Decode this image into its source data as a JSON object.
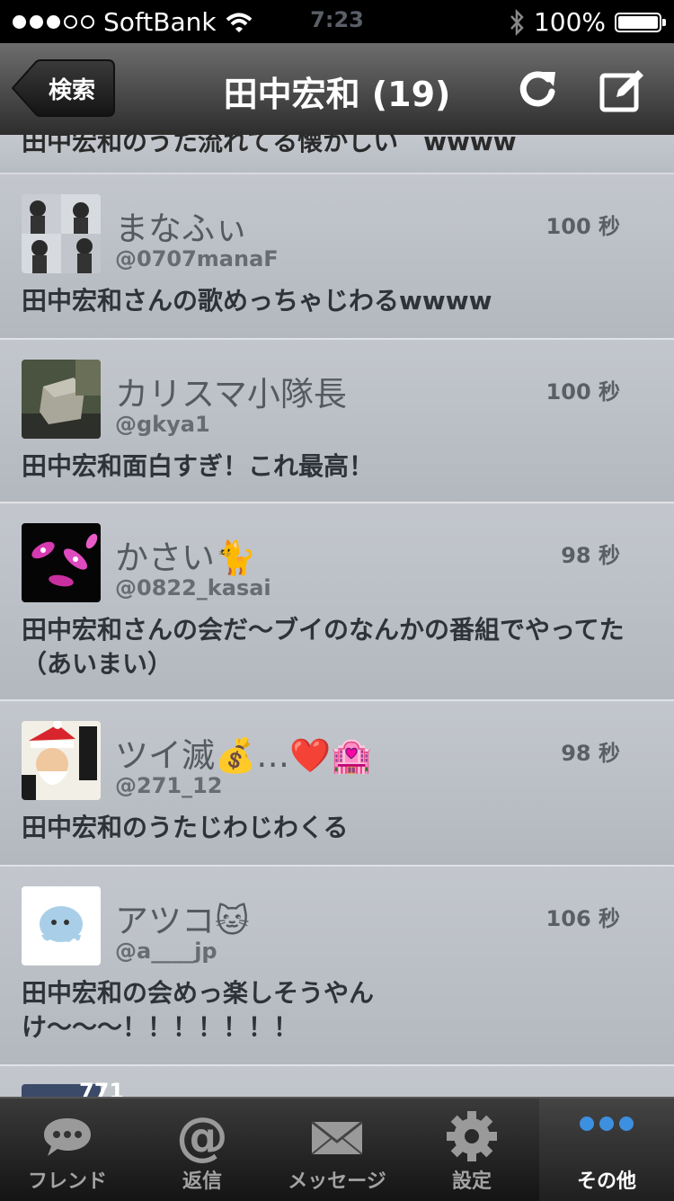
{
  "status_bar": {
    "carrier": "SoftBank",
    "time": "7:23",
    "battery": "100%"
  },
  "nav": {
    "back_label": "検索",
    "title": "田中宏和 (19)",
    "refresh_icon": "refresh-icon",
    "compose_icon": "compose-icon"
  },
  "partial_top_text": "田中宏和のうた流れてる懐かしい　wwww",
  "tweets": [
    {
      "name": "まなふぃ",
      "handle": "@0707manaF",
      "time": "100 秒",
      "text": "田中宏和さんの歌めっちゃじわるwwww"
    },
    {
      "name": "カリスマ小隊長",
      "handle": "@gkya1",
      "time": "100 秒",
      "text": "田中宏和面白すぎ！これ最高！"
    },
    {
      "name": "かさい🐈",
      "handle": "@0822_kasai",
      "time": "98 秒",
      "text": "田中宏和さんの会だ〜ブイのなんかの番組でやってた（あいまい）"
    },
    {
      "name": "ツイ滅💰…❤️🏩",
      "handle": "@271_12",
      "time": "98 秒",
      "text": "田中宏和のうたじわじわくる"
    },
    {
      "name": "アツコ🐱",
      "handle": "@a____jp",
      "time": "106 秒",
      "text": "田中宏和の会めっ楽しそうやんけ〜〜〜！！！！！！！"
    }
  ],
  "partial_bottom_name": "771",
  "tabs": [
    {
      "label": "フレンド",
      "icon": "speech-bubble-icon"
    },
    {
      "label": "返信",
      "icon": "at-sign-icon"
    },
    {
      "label": "メッセージ",
      "icon": "envelope-icon"
    },
    {
      "label": "設定",
      "icon": "gear-icon"
    },
    {
      "label": "その他",
      "icon": "more-dots-icon"
    }
  ]
}
